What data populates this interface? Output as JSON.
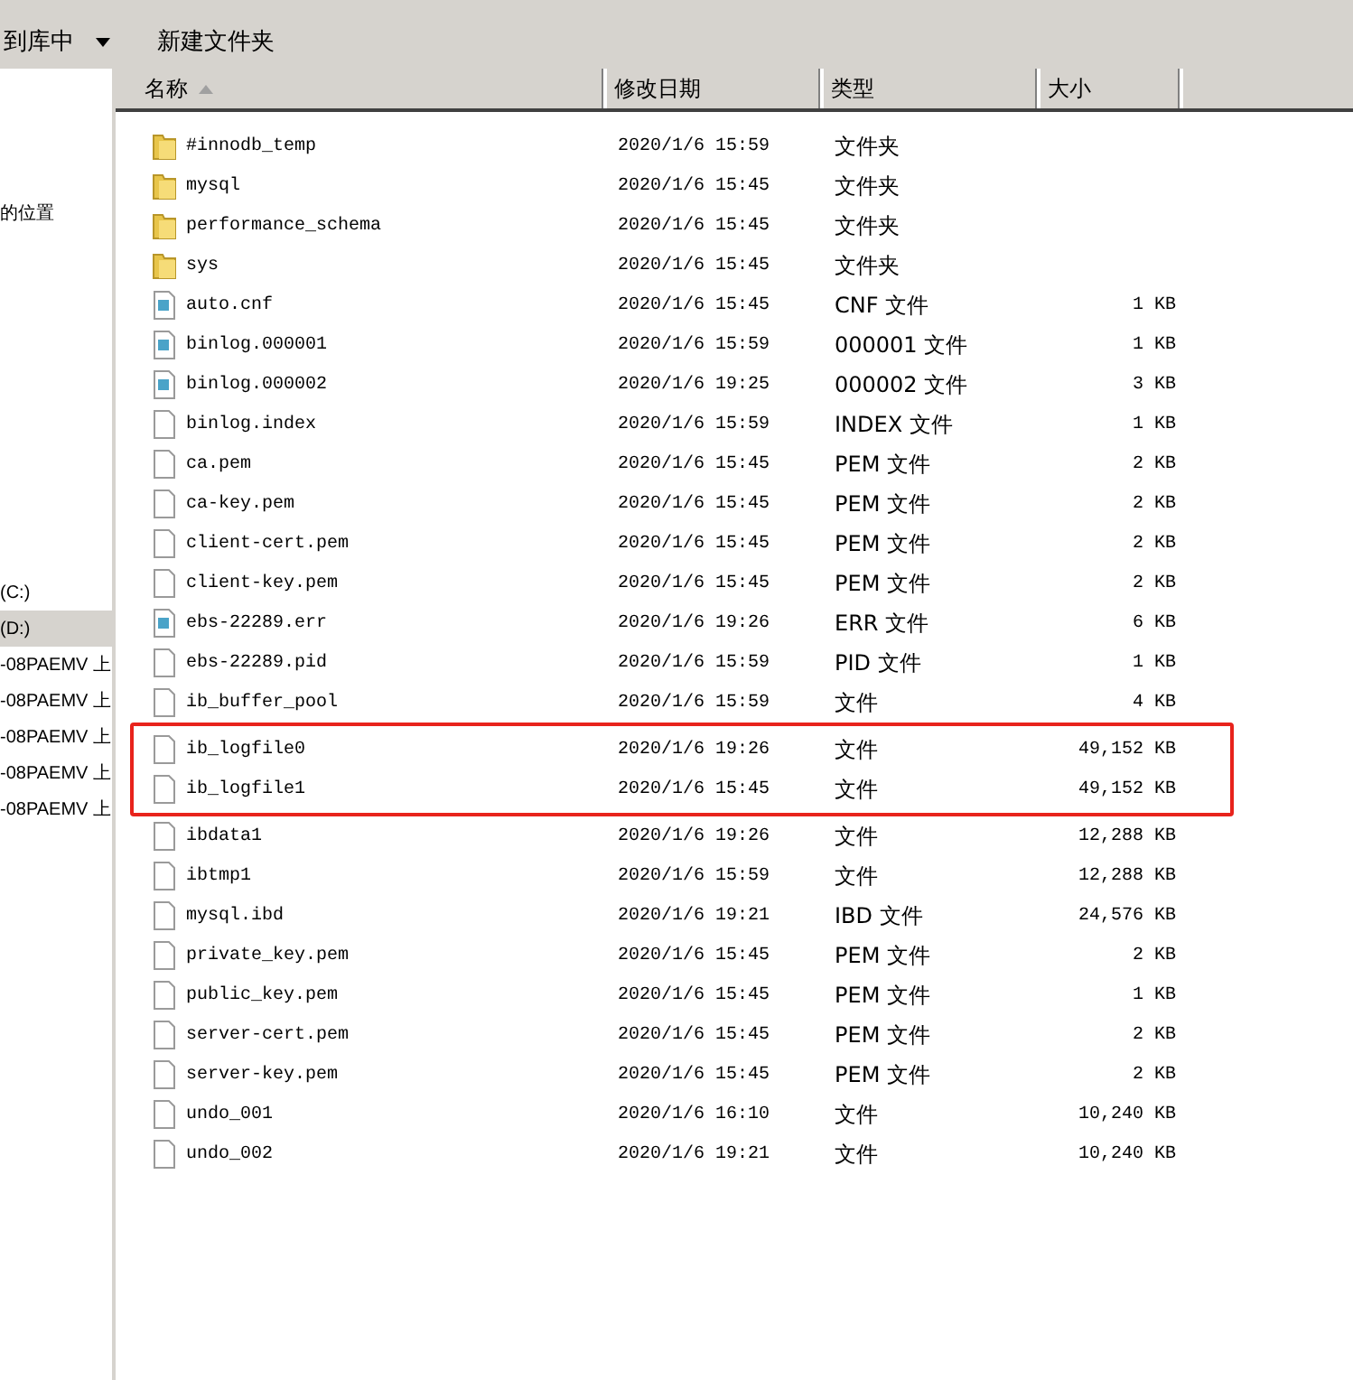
{
  "toolbar": {
    "items": [
      {
        "label": "到库中",
        "dropdown": true
      },
      {
        "label": "新建文件夹",
        "dropdown": false
      }
    ]
  },
  "sidebar": {
    "items": [
      {
        "label": "的位置",
        "selected": false
      },
      {
        "label": "(C:)",
        "selected": false
      },
      {
        "label": "(D:)",
        "selected": true
      },
      {
        "label": "-08PAEMV 上",
        "selected": false
      },
      {
        "label": "-08PAEMV 上",
        "selected": false
      },
      {
        "label": "-08PAEMV 上",
        "selected": false
      },
      {
        "label": "-08PAEMV 上",
        "selected": false
      },
      {
        "label": "-08PAEMV 上",
        "selected": false
      }
    ]
  },
  "table": {
    "columns": [
      {
        "label": "名称",
        "sorted": true
      },
      {
        "label": "修改日期",
        "sorted": false
      },
      {
        "label": "类型",
        "sorted": false
      },
      {
        "label": "大小",
        "sorted": false
      }
    ],
    "row_groups": [
      {
        "highlighted": false,
        "rows": [
          {
            "kind": "folder",
            "name": "#innodb_temp",
            "date": "2020/1/6 15:59",
            "type": "文件夹"
          },
          {
            "kind": "folder",
            "name": "mysql",
            "date": "2020/1/6 15:45",
            "type": "文件夹"
          },
          {
            "kind": "folder",
            "name": "performance_schema",
            "date": "2020/1/6 15:45",
            "type": "文件夹"
          },
          {
            "kind": "folder",
            "name": "sys",
            "date": "2020/1/6 15:45",
            "type": "文件夹"
          },
          {
            "kind": "registered",
            "name": "auto.cnf",
            "date": "2020/1/6 15:45",
            "type": "CNF 文件",
            "size": "1 KB"
          },
          {
            "kind": "registered",
            "name": "binlog.000001",
            "date": "2020/1/6 15:59",
            "type": "000001 文件",
            "size": "1 KB"
          },
          {
            "kind": "registered",
            "name": "binlog.000002",
            "date": "2020/1/6 19:25",
            "type": "000002 文件",
            "size": "3 KB"
          },
          {
            "kind": "file",
            "name": "binlog.index",
            "date": "2020/1/6 15:59",
            "type": "INDEX 文件",
            "size": "1 KB"
          },
          {
            "kind": "file",
            "name": "ca.pem",
            "date": "2020/1/6 15:45",
            "type": "PEM 文件",
            "size": "2 KB"
          },
          {
            "kind": "file",
            "name": "ca-key.pem",
            "date": "2020/1/6 15:45",
            "type": "PEM 文件",
            "size": "2 KB"
          },
          {
            "kind": "file",
            "name": "client-cert.pem",
            "date": "2020/1/6 15:45",
            "type": "PEM 文件",
            "size": "2 KB"
          },
          {
            "kind": "file",
            "name": "client-key.pem",
            "date": "2020/1/6 15:45",
            "type": "PEM 文件",
            "size": "2 KB"
          },
          {
            "kind": "registered",
            "name": "ebs-22289.err",
            "date": "2020/1/6 19:26",
            "type": "ERR 文件",
            "size": "6 KB"
          },
          {
            "kind": "file",
            "name": "ebs-22289.pid",
            "date": "2020/1/6 15:59",
            "type": "PID 文件",
            "size": "1 KB"
          },
          {
            "kind": "file",
            "name": "ib_buffer_pool",
            "date": "2020/1/6 15:59",
            "type": "文件",
            "size": "4 KB"
          }
        ]
      },
      {
        "highlighted": true,
        "rows": [
          {
            "kind": "file",
            "name": "ib_logfile0",
            "date": "2020/1/6 19:26",
            "type": "文件",
            "size": "49,152 KB"
          },
          {
            "kind": "file",
            "name": "ib_logfile1",
            "date": "2020/1/6 15:45",
            "type": "文件",
            "size": "49,152 KB"
          }
        ]
      },
      {
        "highlighted": false,
        "rows": [
          {
            "kind": "file",
            "name": "ibdata1",
            "date": "2020/1/6 19:26",
            "type": "文件",
            "size": "12,288 KB"
          },
          {
            "kind": "file",
            "name": "ibtmp1",
            "date": "2020/1/6 15:59",
            "type": "文件",
            "size": "12,288 KB"
          },
          {
            "kind": "file",
            "name": "mysql.ibd",
            "date": "2020/1/6 19:21",
            "type": "IBD 文件",
            "size": "24,576 KB"
          },
          {
            "kind": "file",
            "name": "private_key.pem",
            "date": "2020/1/6 15:45",
            "type": "PEM 文件",
            "size": "2 KB"
          },
          {
            "kind": "file",
            "name": "public_key.pem",
            "date": "2020/1/6 15:45",
            "type": "PEM 文件",
            "size": "1 KB"
          },
          {
            "kind": "file",
            "name": "server-cert.pem",
            "date": "2020/1/6 15:45",
            "type": "PEM 文件",
            "size": "2 KB"
          },
          {
            "kind": "file",
            "name": "server-key.pem",
            "date": "2020/1/6 15:45",
            "type": "PEM 文件",
            "size": "2 KB"
          },
          {
            "kind": "file",
            "name": "undo_001",
            "date": "2020/1/6 16:10",
            "type": "文件",
            "size": "10,240 KB"
          },
          {
            "kind": "file",
            "name": "undo_002",
            "date": "2020/1/6 19:21",
            "type": "文件",
            "size": "10,240 KB"
          }
        ]
      }
    ]
  }
}
